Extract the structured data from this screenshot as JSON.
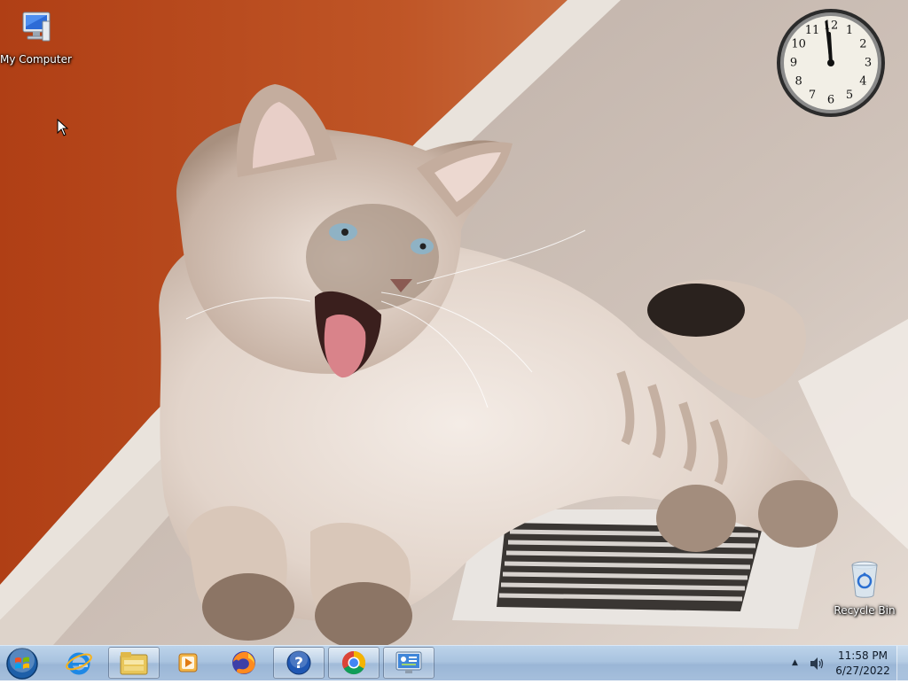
{
  "desktop": {
    "icons": [
      {
        "label": "My Computer",
        "icon": "computer-icon"
      },
      {
        "label": "Recycle Bin",
        "icon": "recycle-bin-icon"
      }
    ],
    "wallpaper": "cat-yawning-on-floor-vent"
  },
  "clock_gadget": {
    "numerals": [
      "12",
      "1",
      "2",
      "3",
      "4",
      "5",
      "6",
      "7",
      "8",
      "9",
      "10",
      "11"
    ],
    "time_shown": "11:58"
  },
  "taskbar": {
    "start_icon": "windows-start-orb",
    "pinned": [
      {
        "name": "internet-explorer",
        "icon": "ie-icon",
        "active": false
      },
      {
        "name": "windows-explorer",
        "icon": "folder-icon",
        "active": true
      },
      {
        "name": "media-player",
        "icon": "media-player-icon",
        "active": false
      },
      {
        "name": "firefox",
        "icon": "firefox-icon",
        "active": false
      },
      {
        "name": "help-and-support",
        "icon": "help-icon",
        "active": true
      },
      {
        "name": "chrome",
        "icon": "chrome-icon",
        "active": true
      },
      {
        "name": "control-panel",
        "icon": "control-panel-icon",
        "active": true
      }
    ],
    "tray": {
      "chevron": "▲",
      "volume_icon": "speaker-icon",
      "time": "11:58 PM",
      "date": "6/27/2022"
    }
  },
  "colors": {
    "taskbar_top": "#bcd3ea",
    "wall_orange": "#b8461c",
    "carpet": "#cbbdb3"
  }
}
